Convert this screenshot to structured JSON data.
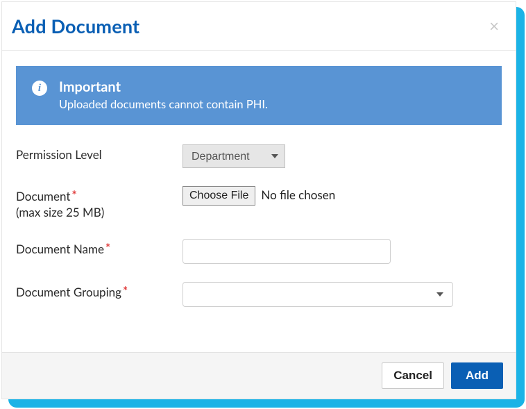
{
  "modal": {
    "title": "Add Document",
    "close_glyph": "×"
  },
  "alert": {
    "title": "Important",
    "text": "Uploaded documents cannot contain PHI.",
    "icon_letter": "i"
  },
  "form": {
    "permission": {
      "label": "Permission Level",
      "selected": "Department"
    },
    "document": {
      "label": "Document",
      "hint": "(max size 25 MB)",
      "button": "Choose File",
      "status": "No file chosen"
    },
    "docname": {
      "label": "Document Name",
      "value": ""
    },
    "grouping": {
      "label": "Document Grouping",
      "selected": ""
    },
    "required_mark": "*"
  },
  "footer": {
    "cancel": "Cancel",
    "add": "Add"
  }
}
